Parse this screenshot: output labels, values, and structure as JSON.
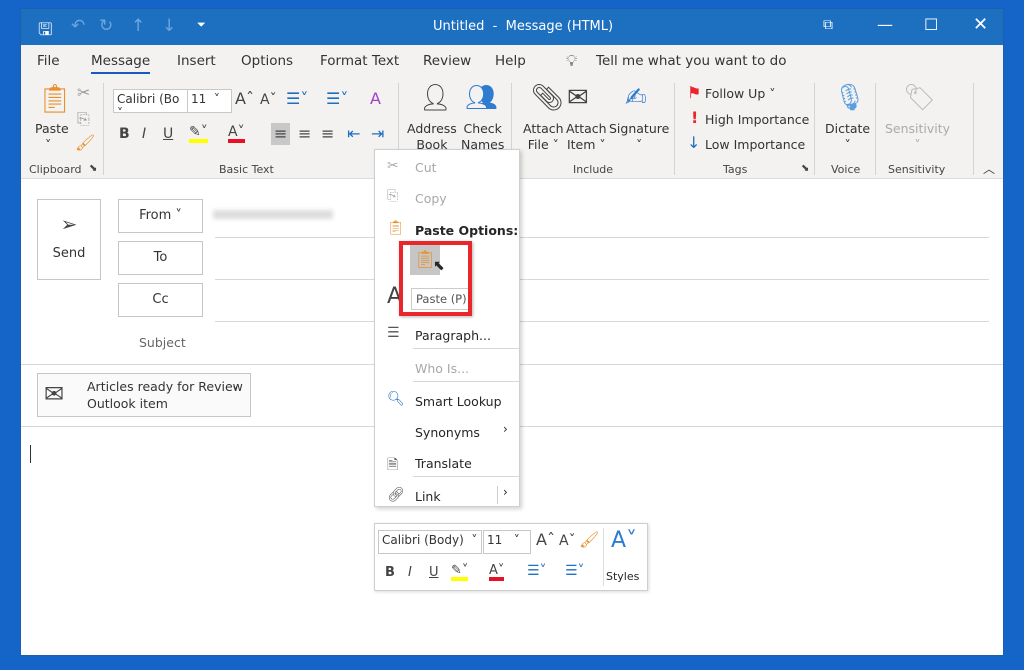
{
  "window": {
    "title": "Untitled  -  Message (HTML)"
  },
  "qat": {
    "icons": [
      "save-icon",
      "undo-icon",
      "redo-icon",
      "up-icon",
      "down-icon",
      "customize-icon"
    ]
  },
  "tabs": [
    "File",
    "Message",
    "Insert",
    "Options",
    "Format Text",
    "Review",
    "Help"
  ],
  "active_tab": "Message",
  "tell_me": "Tell me what you want to do",
  "ribbon": {
    "clipboard": {
      "paste": "Paste",
      "group": "Clipboard"
    },
    "basic_text": {
      "font": "Calibri (Bo",
      "size": "11",
      "group": "Basic Text",
      "bold": "B",
      "italic": "I",
      "underline": "U"
    },
    "names": {
      "address_book": [
        "Address",
        "Book"
      ],
      "check_names": [
        "Check",
        "Names"
      ]
    },
    "include": {
      "attach_file": [
        "Attach",
        "File ˅"
      ],
      "attach_item": [
        "Attach",
        "Item ˅"
      ],
      "signature": "Signature",
      "group": "Include"
    },
    "tags": {
      "follow_up": "Follow Up ˅",
      "high": "High Importance",
      "low": "Low Importance",
      "group": "Tags"
    },
    "voice": {
      "dictate": "Dictate",
      "group": "Voice"
    },
    "sensitivity": {
      "button": "Sensitivity",
      "group": "Sensitivity"
    }
  },
  "compose": {
    "send": "Send",
    "from": "From",
    "to": "To",
    "cc": "Cc",
    "subject": "Subject",
    "attachment": {
      "title": "Articles ready for Review",
      "subtitle": "Outlook item"
    }
  },
  "context_menu": {
    "cut": "Cut",
    "copy": "Copy",
    "paste_options": "Paste Options:",
    "paste_tooltip": "Paste (P)",
    "paragraph": "Paragraph...",
    "who_is": "Who Is...",
    "smart_lookup": "Smart Lookup",
    "synonyms": "Synonyms",
    "translate": "Translate",
    "link": "Link"
  },
  "mini_toolbar": {
    "font": "Calibri (Body)",
    "size": "11",
    "styles": "Styles",
    "bold": "B",
    "italic": "I",
    "underline": "U"
  },
  "colors": {
    "titlebar": "#1d6fc0",
    "accent": "#185abd",
    "highlight": "#ffff00",
    "font_color": "#e81123",
    "annotation": "#e8262c"
  }
}
